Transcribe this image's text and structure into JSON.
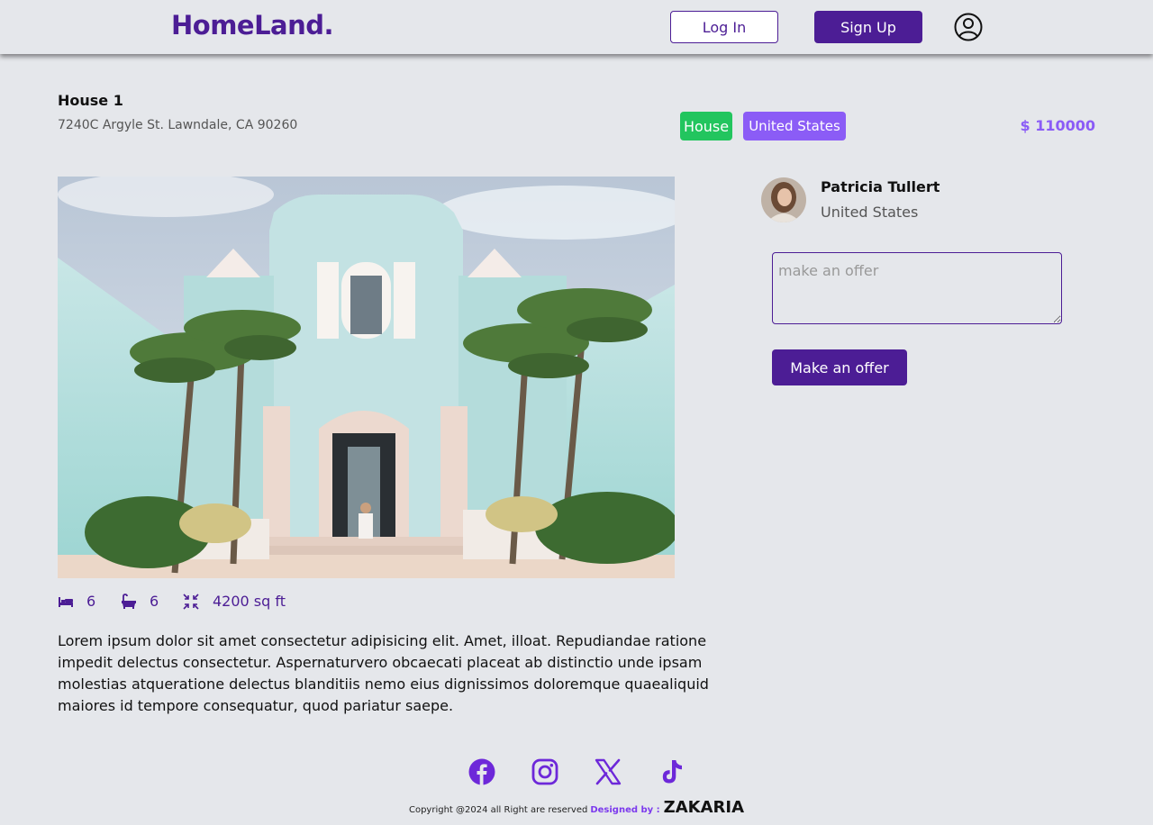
{
  "navbar": {
    "logo": "HomeLand.",
    "login_label": "Log In",
    "signup_label": "Sign Up",
    "user_icon": "user-circle-icon"
  },
  "listing": {
    "title": "House 1",
    "address": "7240C Argyle St. Lawndale, CA 90260",
    "type_tag": "House",
    "country_tag": "United States",
    "price": "$ 110000",
    "bedrooms": "6",
    "bathrooms": "6",
    "area": "4200 sq ft",
    "description": "Lorem ipsum dolor sit amet consectetur adipisicing elit. Amet, illoat. Repudiandae ratione impedit delectus consectetur. Aspernaturvero obcaecati placeat ab distinctio unde ipsam molestias atqueratione delectus blanditiis nemo eius dignissimos doloremque quaealiquid maiores id tempore consequatur, quod pariatur saepe."
  },
  "agent": {
    "name": "Patricia Tullert",
    "country": "United States"
  },
  "offer": {
    "placeholder": "make an offer",
    "button_label": "Make an offer"
  },
  "footer": {
    "socials": [
      "facebook-icon",
      "instagram-icon",
      "x-icon",
      "tiktok-icon"
    ],
    "copyright": "Copyright @2024 all Right are reserved",
    "designed_by": "Designed by :",
    "author": "ZAKARIA"
  },
  "colors": {
    "primary": "#4c1d95",
    "accent": "#8b5cf6",
    "tag_green": "#22c55e",
    "background": "#e5e7eb"
  }
}
